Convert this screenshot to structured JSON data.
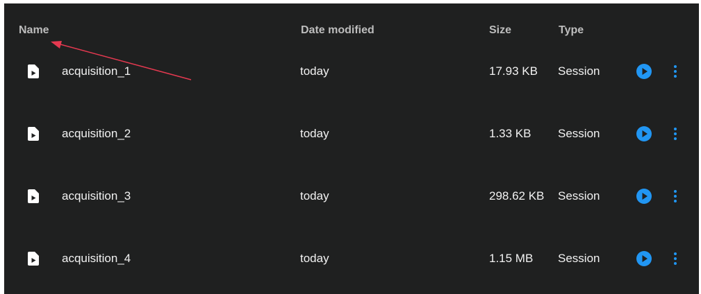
{
  "header": {
    "name": "Name",
    "date_modified": "Date modified",
    "size": "Size",
    "type": "Type"
  },
  "rows": [
    {
      "name": "acquisition_1",
      "date": "today",
      "size": "17.93 KB",
      "type": "Session"
    },
    {
      "name": "acquisition_2",
      "date": "today",
      "size": "1.33 KB",
      "type": "Session"
    },
    {
      "name": "acquisition_3",
      "date": "today",
      "size": "298.62 KB",
      "type": "Session"
    },
    {
      "name": "acquisition_4",
      "date": "today",
      "size": "1.15 MB",
      "type": "Session"
    }
  ],
  "icons": {
    "file": "file-play-icon",
    "play": "play-circle-icon",
    "more": "more-vertical-icon",
    "annotation": "annotation-arrow"
  },
  "colors": {
    "background": "#1f2020",
    "header_text": "#bdbdbd",
    "row_text": "#f2f2f2",
    "accent": "#2196f3",
    "annotation": "#e53950"
  }
}
